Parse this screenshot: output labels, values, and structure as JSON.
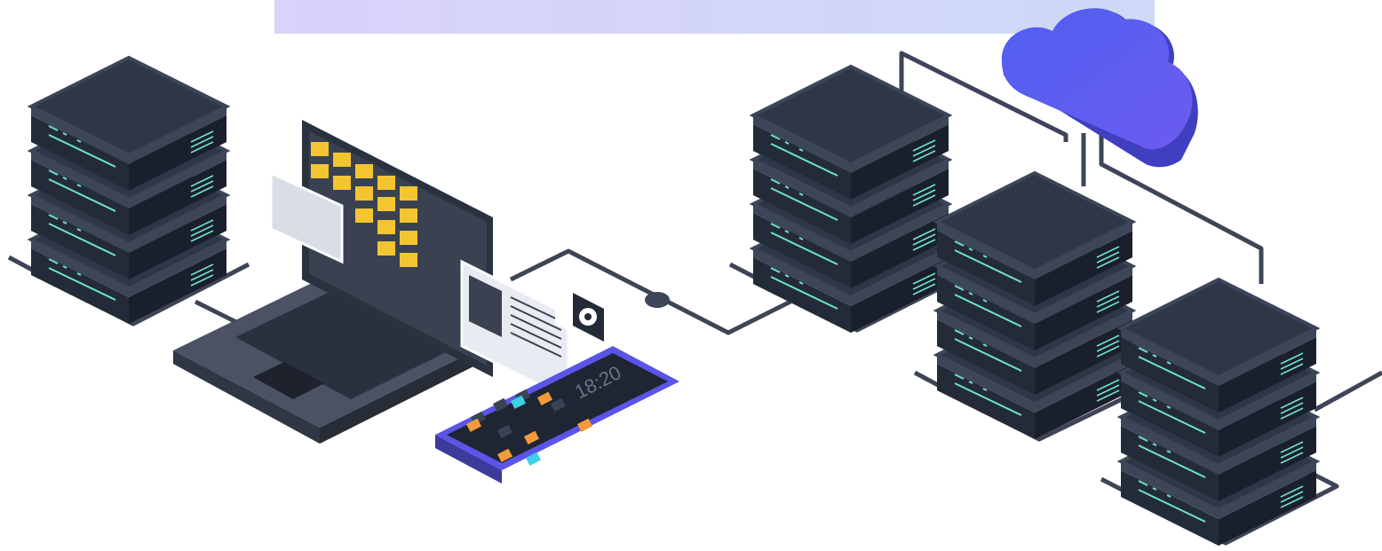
{
  "colors": {
    "banner_start": "#d9d2fa",
    "banner_end": "#cdd9f6",
    "server_top": "#2e3748",
    "server_edge": "#3c4658",
    "server_body": "#232b39",
    "server_band": "#5a55e8",
    "teal_led": "#6fe3c8",
    "cable": "#3d4556",
    "cloud_start": "#4f5ff0",
    "cloud_end": "#6c5cf0",
    "folder": "#f2c531",
    "laptop_body": "#4a5263",
    "phone_screen": "#1f2533",
    "orange_key": "#f39b3b",
    "cyan_key": "#3ed0e6"
  },
  "icons": {
    "cloud": "cloud-icon",
    "gear": "gear-icon",
    "folder": "folder-icon",
    "document": "document-icon"
  },
  "phone": {
    "clock": "18:20"
  }
}
